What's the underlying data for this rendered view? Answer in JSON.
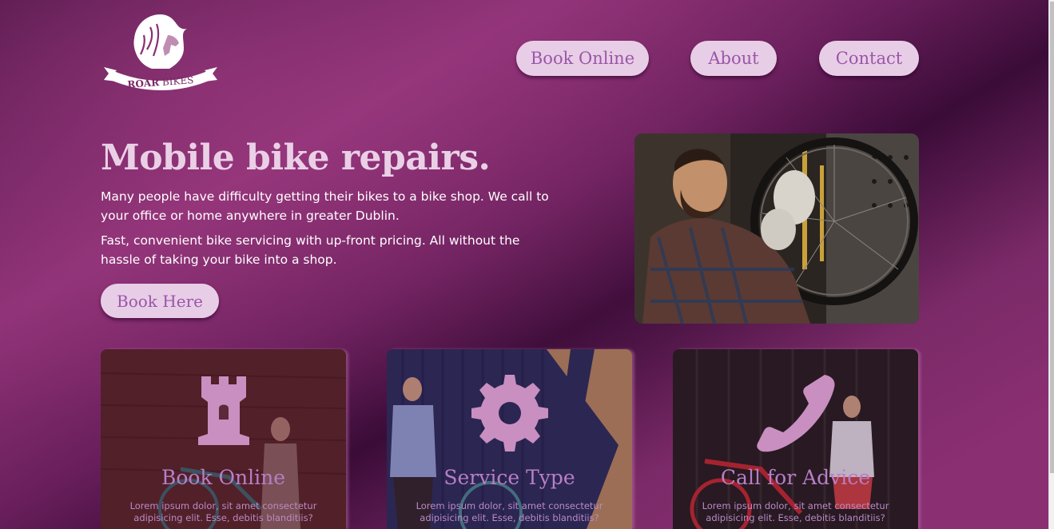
{
  "brand": {
    "name_bold": "ROAR",
    "name_light": "BIKES",
    "logo_icon": "lion-head-icon"
  },
  "nav": {
    "book_online": "Book Online",
    "about": "About",
    "contact": "Contact"
  },
  "hero": {
    "title": "Mobile bike repairs.",
    "paragraph1": "Many people have difficulty getting their bikes to a bike shop. We call to your office or home anywhere in greater Dublin.",
    "paragraph2": "Fast, convenient bike servicing with up-front pricing. All without the hassle of taking your bike into a shop.",
    "cta": "Book Here"
  },
  "cards": [
    {
      "title": "Book Online",
      "text": "Lorem ipsum dolor, sit amet consectetur adipisicing elit. Esse, debitis blanditiis?",
      "icon": "castle-tower-icon"
    },
    {
      "title": "Service Type",
      "text": "Lorem ipsum dolor, sit amet consectetur adipisicing elit. Esse, debitis blanditiis?",
      "icon": "gear-icon"
    },
    {
      "title": "Call for Advice",
      "text": "Lorem ipsum dolor, sit amet consectetur adipisicing elit. Esse, debitis blanditiis?",
      "icon": "phone-icon"
    }
  ],
  "colors": {
    "button_bg": "#e8cde6",
    "button_text": "#9a56a8",
    "title_text": "#ead0e6",
    "card_title": "#b77fc6",
    "icon_fill": "#c98fc0"
  }
}
